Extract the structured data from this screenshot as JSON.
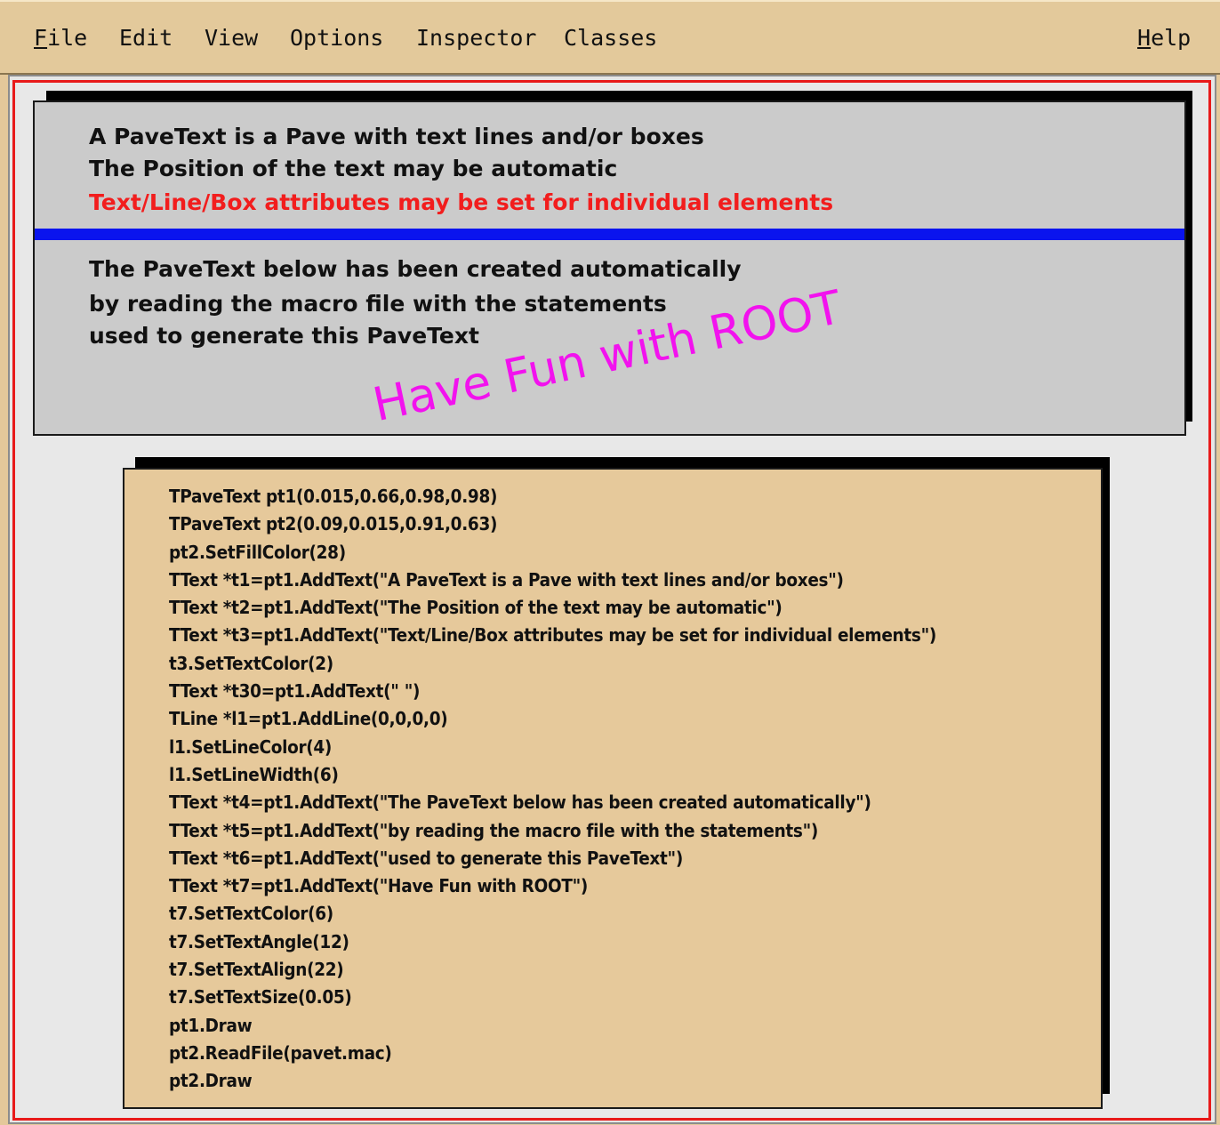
{
  "menubar": {
    "items": [
      {
        "key": "file",
        "label_first": "F",
        "label_rest": "ile"
      },
      {
        "key": "edit",
        "label_first": "",
        "label_rest": "Edit"
      },
      {
        "key": "view",
        "label_first": "",
        "label_rest": "View"
      },
      {
        "key": "options",
        "label_first": "",
        "label_rest": "Options"
      },
      {
        "key": "inspector",
        "label_first": "",
        "label_rest": "Inspector"
      },
      {
        "key": "classes",
        "label_first": "",
        "label_rest": "Classes"
      },
      {
        "key": "help",
        "label_first": "H",
        "label_rest": "elp"
      }
    ]
  },
  "pave1": {
    "lines": [
      "A PaveText is a Pave with text lines and/or boxes",
      "The Position of the text may be automatic",
      "Text/Line/Box attributes may be set for individual elements",
      "The PaveText below has been created automatically",
      "by reading the macro file with the statements",
      "used to generate this PaveText"
    ],
    "fun_text": "Have Fun with ROOT",
    "colors": {
      "fill": "#cbcbcb",
      "red_text": "#f21d1d",
      "line": "#0a14ee",
      "fun_text": "#f212ee"
    }
  },
  "pave2": {
    "fill_color": "#e6c99b",
    "lines": [
      "TPaveText pt1(0.015,0.66,0.98,0.98)",
      "TPaveText pt2(0.09,0.015,0.91,0.63)",
      "pt2.SetFillColor(28)",
      "TText *t1=pt1.AddText(\"A PaveText is a Pave with text lines and/or boxes\")",
      "TText *t2=pt1.AddText(\"The Position of the text may be automatic\")",
      "TText *t3=pt1.AddText(\"Text/Line/Box attributes may be set for individual elements\")",
      "t3.SetTextColor(2)",
      "TText *t30=pt1.AddText(\" \")",
      "TLine *l1=pt1.AddLine(0,0,0,0)",
      "l1.SetLineColor(4)",
      "l1.SetLineWidth(6)",
      "TText *t4=pt1.AddText(\"The PaveText below has been created automatically\")",
      "TText *t5=pt1.AddText(\"by reading the macro file with the statements\")",
      "TText *t6=pt1.AddText(\"used to generate this PaveText\")",
      "TText *t7=pt1.AddText(\"Have Fun with ROOT\")",
      "t7.SetTextColor(6)",
      "t7.SetTextAngle(12)",
      "t7.SetTextAlign(22)",
      "t7.SetTextSize(0.05)",
      "pt1.Draw",
      "pt2.ReadFile(pavet.mac)",
      "pt2.Draw"
    ]
  }
}
